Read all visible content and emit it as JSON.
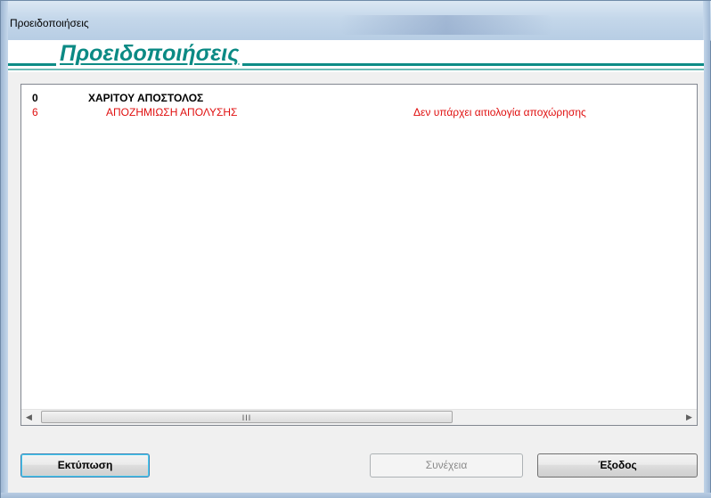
{
  "window": {
    "title": "Προειδοποιήσεις"
  },
  "header": {
    "title": "Προειδοποιήσεις"
  },
  "list": {
    "rows": [
      {
        "code": "0",
        "name": "ΧΑΡΙΤΟΥ ΑΠΟΣΤΟΛΟΣ",
        "message": ""
      },
      {
        "code": "6",
        "name": "ΑΠΟΖΗΜΙΩΣΗ ΑΠΟΛΥΣΗΣ",
        "message": "Δεν υπάρχει αιτιολογία αποχώρησης"
      }
    ]
  },
  "scrollbar": {
    "left_arrow": "◀",
    "right_arrow": "▶",
    "grip": "III"
  },
  "buttons": {
    "print": "Εκτύπωση",
    "continue": "Συνέχεια",
    "exit": "Έξοδος"
  },
  "colors": {
    "accent": "#0b8a84",
    "warning": "#e01010"
  }
}
